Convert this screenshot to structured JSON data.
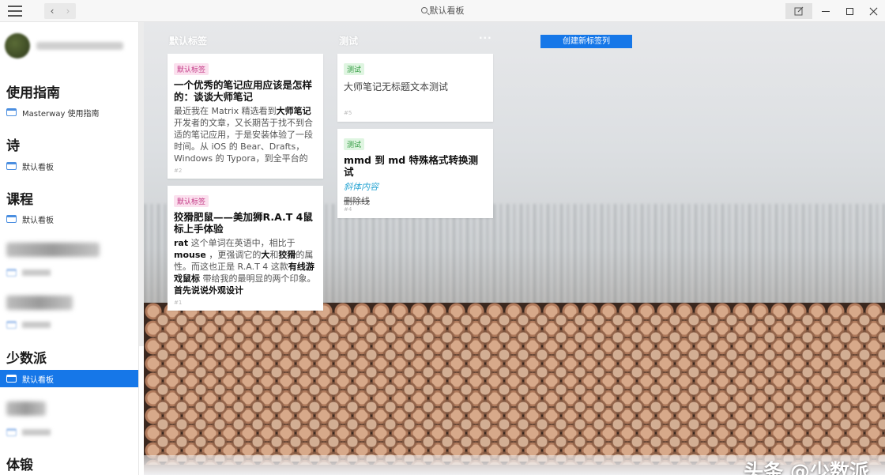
{
  "titlebar": {
    "back": "‹",
    "forward": "›",
    "search_text": "默认看板"
  },
  "sidebar": {
    "sections": [
      {
        "title": "使用指南",
        "items": [
          "Masterway 使用指南"
        ]
      },
      {
        "title": "诗",
        "items": [
          "默认看板"
        ]
      },
      {
        "title": "课程",
        "items": [
          "默认看板"
        ]
      },
      {
        "title": "少数派",
        "items": [
          "默认看板"
        ]
      },
      {
        "title": "体锻",
        "items": []
      }
    ]
  },
  "main": {
    "columns": [
      {
        "title": "默认标签",
        "cards": [
          {
            "tag": "默认标签",
            "title": "一个优秀的笔记应用应该是怎样的：谈谈大师笔记",
            "body_parts": [
              [
                "最近我在 Matrix 精选看到",
                false
              ],
              [
                "大师笔记",
                true
              ],
              [
                "开发者的文章，又长期苦于找不到合适的笔记应用，于是安装体验了一段时间。从 iOS 的 Bear、Drafts，Windows 的 Typora，到全平台的 Notion，以及今天推荐的",
                false
              ]
            ],
            "num": "#2"
          },
          {
            "tag": "默认标签",
            "title": "狡猾肥鼠——美加狮R.A.T 4鼠标上手体验",
            "body_parts": [
              [
                "rat",
                true
              ],
              [
                " 这个单词在英语中，相比于 ",
                false
              ],
              [
                "mouse",
                true
              ],
              [
                " ，更强调它的",
                false
              ],
              [
                "大",
                true
              ],
              [
                "和",
                false
              ],
              [
                "狡猾",
                true
              ],
              [
                "的属性。而这也正是 R.A.T 4 这款",
                false
              ],
              [
                "有线游戏鼠标",
                true
              ],
              [
                " 带给我的最明显的两个印象。",
                false
              ],
              [
                "\n首先说说外观设计",
                true
              ]
            ],
            "num": "#1"
          }
        ]
      },
      {
        "title": "测试",
        "menu": "···",
        "cards": [
          {
            "tag": "测试",
            "body": "大师笔记无标题文本测试",
            "num": "#5"
          },
          {
            "tag": "测试",
            "title": "mmd 到 md 特殊格式转换测试",
            "italic": "斜体内容",
            "strike": "删除线",
            "num": "#4"
          }
        ]
      }
    ],
    "new_column_button": "创建新标签列"
  },
  "watermark": "头条 @少数派",
  "colors": {
    "accent": "#1677e8",
    "tag_pink_bg": "#fbe0ee",
    "tag_green_bg": "#dff5e1"
  }
}
